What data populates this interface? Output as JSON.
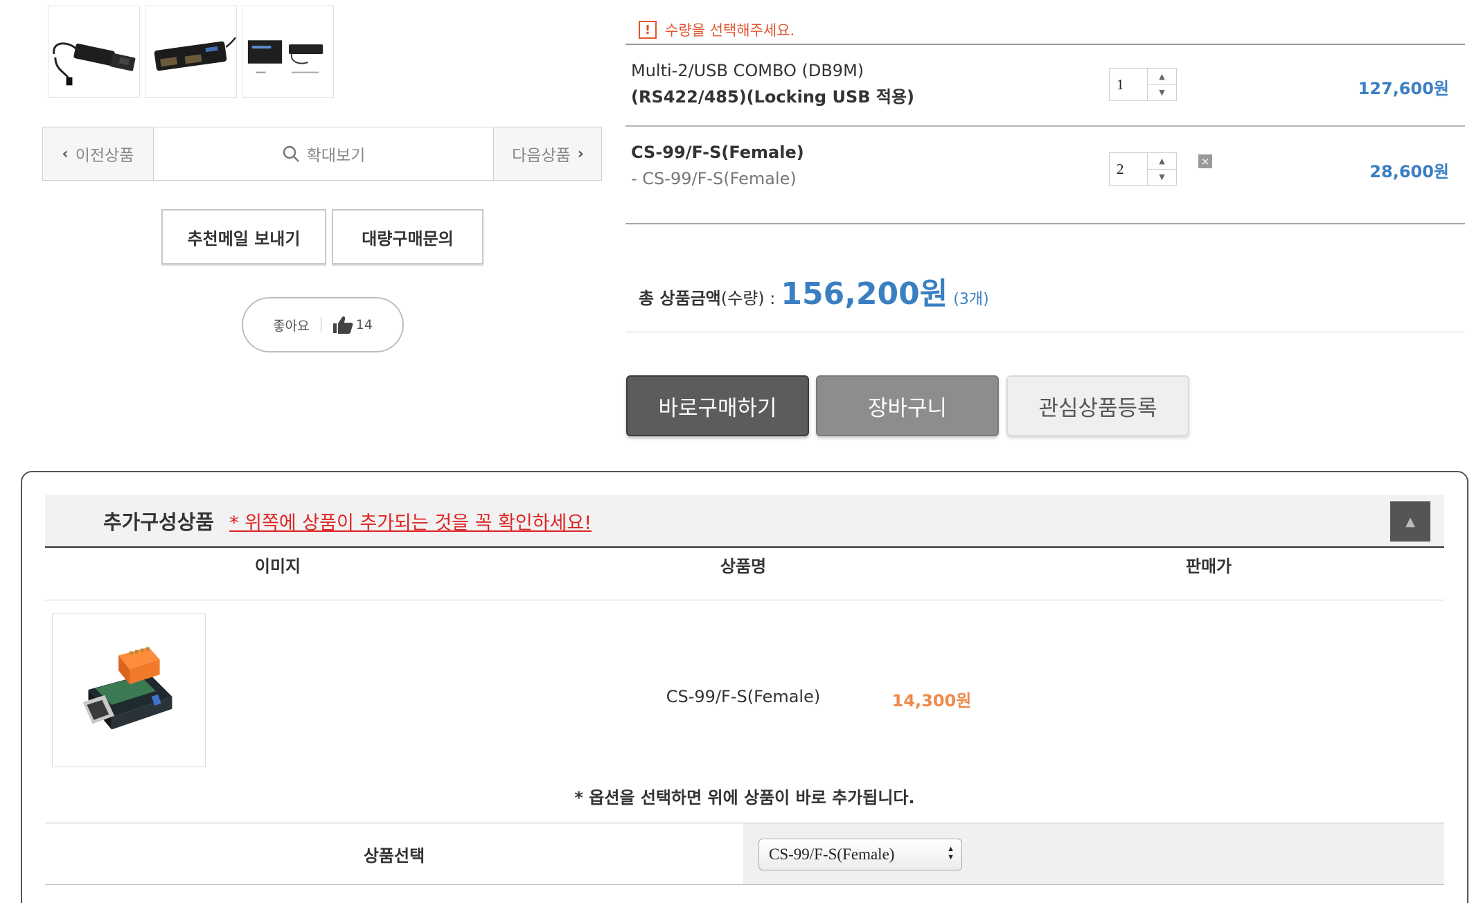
{
  "thumbnails": [
    {
      "name": "thumb-1"
    },
    {
      "name": "thumb-2"
    },
    {
      "name": "thumb-3"
    }
  ],
  "nav": {
    "prev_label": "이전상품",
    "zoom_label": "확대보기",
    "next_label": "다음상품"
  },
  "actions": {
    "recommend_mail": "추천메일 보내기",
    "bulk_inquiry": "대량구매문의"
  },
  "like": {
    "label": "좋아요",
    "count": "14"
  },
  "order": {
    "warning": "수량을 선택해주세요.",
    "items": [
      {
        "name_line1": "Multi-2/USB COMBO (DB9M)",
        "name_line2": "(RS422/485)(Locking USB 적용)",
        "qty": "1",
        "price": "127,600원"
      },
      {
        "name_line1": "CS-99/F-S(Female)",
        "name_line2": "- CS-99/F-S(Female)",
        "qty": "2",
        "price": "28,600원",
        "delete": "×"
      }
    ],
    "total_label_bold": "총 상품금액",
    "total_label_rest": "(수량) :",
    "total_amount": "156,200원",
    "total_count": "(3개)"
  },
  "buttons": {
    "buy_now": "바로구매하기",
    "cart": "장바구니",
    "wishlist": "관심상품등록"
  },
  "addon": {
    "title": "추가구성상품",
    "notice": "* 위쪽에 상품이 추가되는 것을 꼭 확인하세요!",
    "headers": [
      "이미지",
      "상품명",
      "판매가"
    ],
    "product_name": "CS-99/F-S(Female)",
    "product_price": "14,300원",
    "option_note": "* 옵션을 선택하면 위에 상품이 바로 추가됩니다.",
    "option_label": "상품선택",
    "option_selected": "CS-99/F-S(Female)"
  },
  "colors": {
    "accent_blue": "#3a7fc2",
    "warning_red": "#e2552f",
    "notice_red": "#e02424",
    "price_orange": "#ee8a4a"
  }
}
